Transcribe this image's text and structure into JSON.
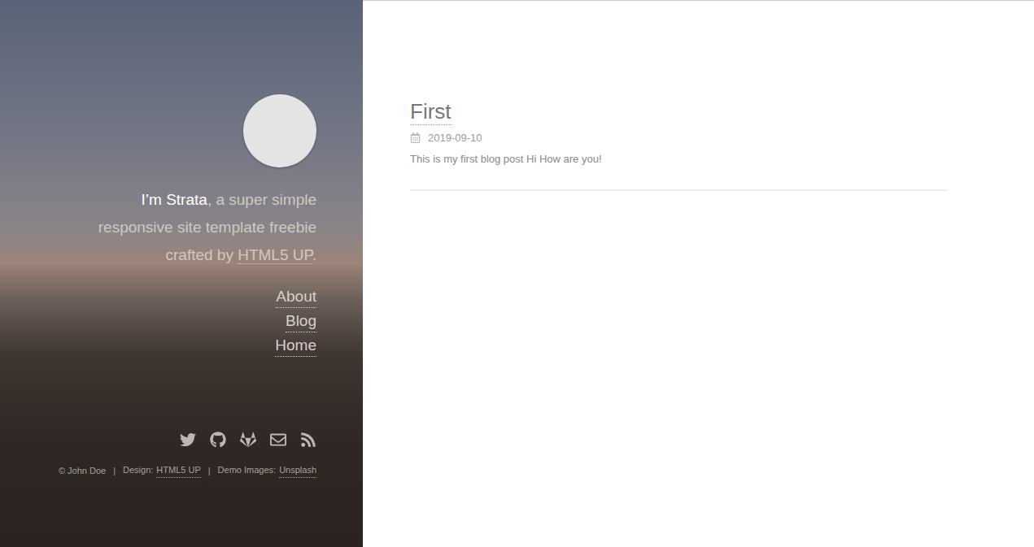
{
  "sidebar": {
    "intro": [
      [
        {
          "text": "I’m Strata",
          "kind": "strong"
        },
        {
          "text": ", a super simple",
          "kind": "plain"
        }
      ],
      [
        {
          "text": "responsive site template freebie",
          "kind": "plain"
        }
      ],
      [
        {
          "text": "crafted by ",
          "kind": "plain"
        },
        {
          "text": "HTML5 UP",
          "kind": "link"
        },
        {
          "text": ".",
          "kind": "plain"
        }
      ]
    ],
    "nav": [
      {
        "label": "About"
      },
      {
        "label": "Blog"
      },
      {
        "label": "Home"
      }
    ],
    "footer": {
      "separator": "|",
      "items": [
        {
          "text": "© John Doe",
          "link": ""
        },
        {
          "text": "Design:",
          "link": "HTML5 UP"
        },
        {
          "text": "Demo Images:",
          "link": "Unsplash"
        }
      ]
    }
  },
  "posts": [
    {
      "title": "First",
      "date": "2019-09-10",
      "excerpt": "This is my first blog post Hi How are you!"
    }
  ]
}
